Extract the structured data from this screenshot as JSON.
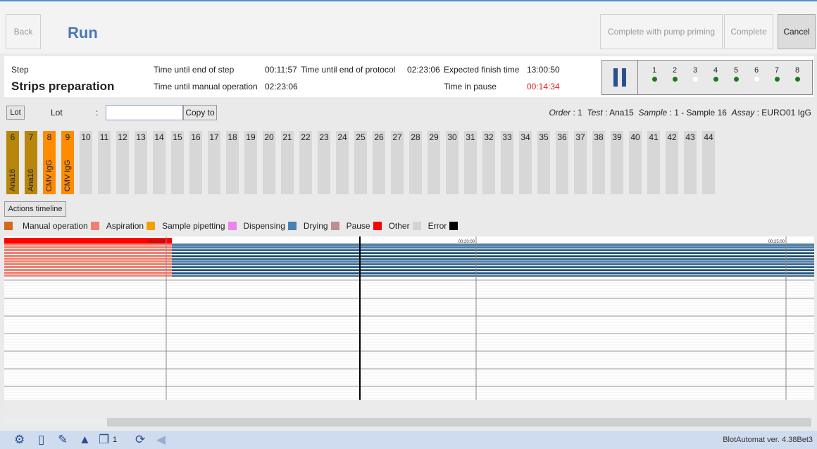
{
  "header": {
    "back_label": "Back",
    "title": "Run",
    "pump_label": "Complete with pump priming",
    "complete_label": "Complete",
    "cancel_label": "Cancel"
  },
  "info": {
    "step_label": "Step",
    "step_name": "Strips preparation",
    "end_step_label": "Time until end of step",
    "end_step_value": "00:11:57",
    "manual_label": "Time until manual operation",
    "manual_value": "02:23:06",
    "end_protocol_label": "Time until end of protocol",
    "end_protocol_value": "02:23:06",
    "finish_label": "Expected finish time",
    "finish_value": "13:00:50",
    "pause_label": "Time in pause",
    "pause_value": "00:14:34"
  },
  "slots": [
    {
      "n": "1",
      "color": "#1a7a1a"
    },
    {
      "n": "2",
      "color": "#1a7a1a"
    },
    {
      "n": "3",
      "color": "#ffffff"
    },
    {
      "n": "4",
      "color": "#1a7a1a"
    },
    {
      "n": "5",
      "color": "#1a7a1a"
    },
    {
      "n": "6",
      "color": "#ffffff"
    },
    {
      "n": "7",
      "color": "#1a7a1a"
    },
    {
      "n": "8",
      "color": "#1a7a1a"
    }
  ],
  "lot": {
    "button_label": "Lot",
    "label": "Lot",
    "colon": ":",
    "input_value": "",
    "copy_label": "Copy to",
    "order_label": "Order",
    "order_value": "1",
    "test_label": "Test",
    "test_value": "Ana15",
    "sample_label": "Sample",
    "sample_value": "1 - Sample 16",
    "assay_label": "Assay",
    "assay_value": "EURO01 IgG"
  },
  "strips": [
    {
      "n": "6",
      "label": "Ana16",
      "color": "#b8860b"
    },
    {
      "n": "7",
      "label": "Ana16",
      "color": "#b8860b"
    },
    {
      "n": "8",
      "label": "CMV IgG",
      "color": "#ff8c00"
    },
    {
      "n": "9",
      "label": "CMV IgG",
      "color": "#ff8c00"
    },
    {
      "n": "10",
      "label": "",
      "color": ""
    },
    {
      "n": "11",
      "label": "",
      "color": ""
    },
    {
      "n": "12",
      "label": "",
      "color": ""
    },
    {
      "n": "13",
      "label": "",
      "color": ""
    },
    {
      "n": "14",
      "label": "",
      "color": ""
    },
    {
      "n": "15",
      "label": "",
      "color": ""
    },
    {
      "n": "16",
      "label": "",
      "color": ""
    },
    {
      "n": "17",
      "label": "",
      "color": ""
    },
    {
      "n": "18",
      "label": "",
      "color": ""
    },
    {
      "n": "19",
      "label": "",
      "color": ""
    },
    {
      "n": "20",
      "label": "",
      "color": ""
    },
    {
      "n": "21",
      "label": "",
      "color": ""
    },
    {
      "n": "22",
      "label": "",
      "color": ""
    },
    {
      "n": "23",
      "label": "",
      "color": ""
    },
    {
      "n": "24",
      "label": "",
      "color": ""
    },
    {
      "n": "25",
      "label": "",
      "color": ""
    },
    {
      "n": "26",
      "label": "",
      "color": ""
    },
    {
      "n": "27",
      "label": "",
      "color": ""
    },
    {
      "n": "28",
      "label": "",
      "color": ""
    },
    {
      "n": "29",
      "label": "",
      "color": ""
    },
    {
      "n": "30",
      "label": "",
      "color": ""
    },
    {
      "n": "31",
      "label": "",
      "color": ""
    },
    {
      "n": "32",
      "label": "",
      "color": ""
    },
    {
      "n": "33",
      "label": "",
      "color": ""
    },
    {
      "n": "34",
      "label": "",
      "color": ""
    },
    {
      "n": "35",
      "label": "",
      "color": ""
    },
    {
      "n": "36",
      "label": "",
      "color": ""
    },
    {
      "n": "37",
      "label": "",
      "color": ""
    },
    {
      "n": "38",
      "label": "",
      "color": ""
    },
    {
      "n": "39",
      "label": "",
      "color": ""
    },
    {
      "n": "40",
      "label": "",
      "color": ""
    },
    {
      "n": "41",
      "label": "",
      "color": ""
    },
    {
      "n": "42",
      "label": "",
      "color": ""
    },
    {
      "n": "43",
      "label": "",
      "color": ""
    },
    {
      "n": "44",
      "label": "",
      "color": ""
    }
  ],
  "actions_label": "Actions timeline",
  "legend": [
    {
      "label": "Manual operation",
      "color": "#f08070"
    },
    {
      "label": "Aspiration",
      "color": "#f5a000"
    },
    {
      "label": "Sample pipetting",
      "color": "#ee82ee"
    },
    {
      "label": "Dispensing",
      "color": "#4682b4"
    },
    {
      "label": "Drying",
      "color": "#bc8f8f"
    },
    {
      "label": "Pause",
      "color": "#ff0000"
    },
    {
      "label": "Other",
      "color": "#d3d3d3"
    },
    {
      "label": "Error",
      "color": "#000000"
    }
  ],
  "legend_lead_color": "#d2691e",
  "timeline": {
    "ticks": [
      "00:15:00",
      "00:20:00",
      "00:25:00"
    ]
  },
  "footer": {
    "copies_count": "1",
    "version": "BlotAutomat ver. 4.38Bet3"
  }
}
